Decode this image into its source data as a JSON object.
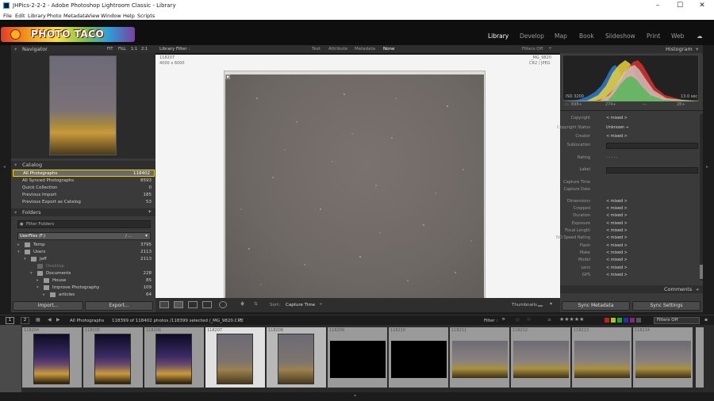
{
  "window": {
    "title": "JHPics-2-2-2 - Adobe Photoshop Lightroom Classic - Library",
    "app_icon": "Lr"
  },
  "menu": [
    "File",
    "Edit",
    "Library",
    "Photo",
    "Metadata",
    "View",
    "Window",
    "Help",
    "Scripts"
  ],
  "logo": {
    "text": "PHOTO TACO"
  },
  "modules": [
    "Library",
    "Develop",
    "Map",
    "Book",
    "Slideshow",
    "Print",
    "Web"
  ],
  "navigator": {
    "title": "Navigator",
    "zoom": [
      "FIT",
      "FILL",
      "1:1",
      "2:1"
    ]
  },
  "catalog": {
    "title": "Catalog",
    "items": [
      {
        "label": "All Photographs",
        "count": "118402",
        "selected": true
      },
      {
        "label": "All Synced Photographs",
        "count": "8593"
      },
      {
        "label": "Quick Collection",
        "count": "0"
      },
      {
        "label": "Previous Import",
        "count": "185"
      },
      {
        "label": "Previous Export as Catalog",
        "count": "53"
      }
    ]
  },
  "folders": {
    "title": "Folders",
    "filter_placeholder": "Filter Folders",
    "volume": {
      "label": "UserFiles (F:)",
      "info": "/ ..."
    },
    "items": [
      {
        "label": "Temp",
        "count": "3795",
        "indent": 0
      },
      {
        "label": "Users",
        "count": "2113",
        "indent": 0
      },
      {
        "label": "Jeff",
        "count": "2113",
        "indent": 1
      },
      {
        "label": "Desktop",
        "count": "",
        "indent": 2
      },
      {
        "label": "Documents",
        "count": "228",
        "indent": 2
      },
      {
        "label": "House",
        "count": "85",
        "indent": 3
      },
      {
        "label": "Improve Photography",
        "count": "109",
        "indent": 3
      },
      {
        "label": "articles",
        "count": "64",
        "indent": 4
      }
    ]
  },
  "left_buttons": {
    "import": "Import...",
    "export": "Export..."
  },
  "filterbar": {
    "title": "Library Filter :",
    "options": [
      "Text",
      "Attribute",
      "Metadata",
      "None"
    ],
    "preset": "Filters Off"
  },
  "photo_info": {
    "left_top": "118207",
    "left_dims": "4000 x 6000",
    "right_name": "_MG_9820",
    "right_fmt": "CR2 / JPEG"
  },
  "toolbar": {
    "sort_label": "Sort:",
    "sort_value": "Capture Time",
    "thumbnails": "Thumbnails"
  },
  "histogram": {
    "title": "Histogram",
    "iso": "ISO 3200",
    "focal": "–",
    "aperture": "–",
    "shutter": "13.0 sec",
    "stats": [
      "698+",
      "274+",
      "—",
      "28+"
    ]
  },
  "metadata": {
    "rows": [
      {
        "label": "Copyright",
        "value": "< mixed >"
      },
      {
        "label": "Copyright Status",
        "value": "Unknown ÷"
      },
      {
        "label": "Creator",
        "value": "< mixed >"
      },
      {
        "label": "Sublocation",
        "value": ""
      },
      {
        "label": "Rating",
        "value": "· · · · ·"
      },
      {
        "label": "Label",
        "value": ""
      },
      {
        "label": "Capture Time",
        "value": ""
      },
      {
        "label": "Capture Date",
        "value": ""
      },
      {
        "label": "Dimensions",
        "value": "< mixed >"
      },
      {
        "label": "Cropped",
        "value": "< mixed >"
      },
      {
        "label": "Duration",
        "value": "< mixed >"
      },
      {
        "label": "Exposure",
        "value": "< mixed >"
      },
      {
        "label": "Focal Length",
        "value": "< mixed >"
      },
      {
        "label": "ISO Speed Rating",
        "value": "< mixed >"
      },
      {
        "label": "Flash",
        "value": "< mixed >"
      },
      {
        "label": "Make",
        "value": "< mixed >"
      },
      {
        "label": "Model",
        "value": "< mixed >"
      },
      {
        "label": "Lens",
        "value": "< mixed >"
      },
      {
        "label": "GPS",
        "value": "< mixed >"
      }
    ],
    "comments": "Comments"
  },
  "right_buttons": {
    "sync_metadata": "Sync Metadata",
    "sync_settings": "Sync Settings"
  },
  "filmstrip_bar": {
    "pages": [
      "1",
      "2"
    ],
    "source": "All Photographs",
    "count_text": "118399 of 118402 photos /118399 selected /_MG_9820.CR2",
    "filter_label": "Filter :",
    "filter_value": "Filters Off"
  },
  "filmstrip": [
    {
      "num": "118204",
      "kind": "sky",
      "portrait": true
    },
    {
      "num": "118205",
      "kind": "sky",
      "portrait": true
    },
    {
      "num": "118206",
      "kind": "sky",
      "portrait": true
    },
    {
      "num": "118207",
      "kind": "dusk",
      "portrait": true,
      "selected": true
    },
    {
      "num": "118208",
      "kind": "dusk",
      "portrait": true
    },
    {
      "num": "118209",
      "kind": "black",
      "portrait": false
    },
    {
      "num": "118210",
      "kind": "black",
      "portrait": false
    },
    {
      "num": "118211",
      "kind": "wide",
      "portrait": false
    },
    {
      "num": "118212",
      "kind": "wide",
      "portrait": false
    },
    {
      "num": "118213",
      "kind": "wide",
      "portrait": false
    },
    {
      "num": "118214",
      "kind": "wide",
      "portrait": false
    }
  ],
  "colors": {
    "selected_outline": "#f2d200",
    "panel_bg": "#3a3a3a",
    "active_module": "#ffffff"
  }
}
